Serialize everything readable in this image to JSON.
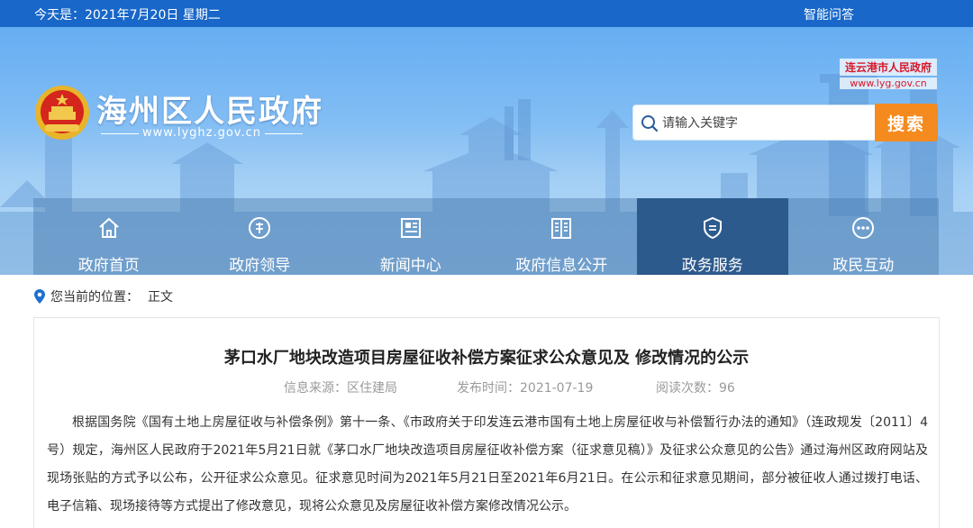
{
  "topbar": {
    "date": "今天是：2021年7月20日 星期二",
    "qa": "智能问答"
  },
  "header": {
    "site_title": "海州区人民政府",
    "site_url": "www.lyghz.gov.cn",
    "parent_site_name": "连云港市人民政府",
    "parent_site_url": "www.lyg.gov.cn"
  },
  "search": {
    "placeholder": "请输入关键字",
    "button_label": "搜索"
  },
  "nav": {
    "items": [
      {
        "label": "政府首页",
        "icon": "home-icon"
      },
      {
        "label": "政府领导",
        "icon": "leader-icon"
      },
      {
        "label": "新闻中心",
        "icon": "news-icon"
      },
      {
        "label": "政府信息公开",
        "icon": "book-icon"
      },
      {
        "label": "政务服务",
        "icon": "shield-icon"
      },
      {
        "label": "政民互动",
        "icon": "chat-icon"
      }
    ],
    "active": "政务服务"
  },
  "breadcrumb": {
    "prefix": "您当前的位置：",
    "current": "正文"
  },
  "article": {
    "title": "茅口水厂地块改造项目房屋征收补偿方案征求公众意见及 修改情况的公示",
    "source": "信息来源：区住建局",
    "publish_time": "发布时间：2021-07-19",
    "views": "阅读次数：96",
    "body": "根据国务院《国有土地上房屋征收与补偿条例》第十一条、《市政府关于印发连云港市国有土地上房屋征收与补偿暂行办法的通知》（连政规发〔2011〕4号）规定，海州区人民政府于2021年5月21日就《茅口水厂地块改造项目房屋征收补偿方案（征求意见稿）》及征求公众意见的公告》通过海州区政府网站及现场张贴的方式予以公布，公开征求公众意见。征求意见时间为2021年5月21日至2021年6月21日。在公示和征求意见期间，部分被征收人通过拨打电话、电子信箱、现场接待等方式提出了修改意见，现将公众意见及房屋征收补偿方案修改情况公示。"
  },
  "colors": {
    "topbar": "#1867c9",
    "search_button": "#f58a1e",
    "nav_active": "#2d5a8c",
    "parent_site_text": "#d8192a"
  }
}
